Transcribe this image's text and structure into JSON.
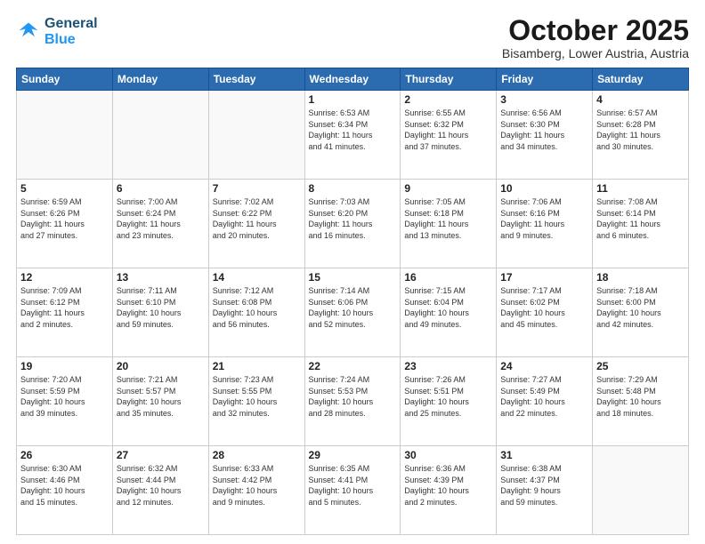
{
  "header": {
    "logo_line1": "General",
    "logo_line2": "Blue",
    "month": "October 2025",
    "location": "Bisamberg, Lower Austria, Austria"
  },
  "days_of_week": [
    "Sunday",
    "Monday",
    "Tuesday",
    "Wednesday",
    "Thursday",
    "Friday",
    "Saturday"
  ],
  "weeks": [
    [
      {
        "day": "",
        "info": ""
      },
      {
        "day": "",
        "info": ""
      },
      {
        "day": "",
        "info": ""
      },
      {
        "day": "1",
        "info": "Sunrise: 6:53 AM\nSunset: 6:34 PM\nDaylight: 11 hours\nand 41 minutes."
      },
      {
        "day": "2",
        "info": "Sunrise: 6:55 AM\nSunset: 6:32 PM\nDaylight: 11 hours\nand 37 minutes."
      },
      {
        "day": "3",
        "info": "Sunrise: 6:56 AM\nSunset: 6:30 PM\nDaylight: 11 hours\nand 34 minutes."
      },
      {
        "day": "4",
        "info": "Sunrise: 6:57 AM\nSunset: 6:28 PM\nDaylight: 11 hours\nand 30 minutes."
      }
    ],
    [
      {
        "day": "5",
        "info": "Sunrise: 6:59 AM\nSunset: 6:26 PM\nDaylight: 11 hours\nand 27 minutes."
      },
      {
        "day": "6",
        "info": "Sunrise: 7:00 AM\nSunset: 6:24 PM\nDaylight: 11 hours\nand 23 minutes."
      },
      {
        "day": "7",
        "info": "Sunrise: 7:02 AM\nSunset: 6:22 PM\nDaylight: 11 hours\nand 20 minutes."
      },
      {
        "day": "8",
        "info": "Sunrise: 7:03 AM\nSunset: 6:20 PM\nDaylight: 11 hours\nand 16 minutes."
      },
      {
        "day": "9",
        "info": "Sunrise: 7:05 AM\nSunset: 6:18 PM\nDaylight: 11 hours\nand 13 minutes."
      },
      {
        "day": "10",
        "info": "Sunrise: 7:06 AM\nSunset: 6:16 PM\nDaylight: 11 hours\nand 9 minutes."
      },
      {
        "day": "11",
        "info": "Sunrise: 7:08 AM\nSunset: 6:14 PM\nDaylight: 11 hours\nand 6 minutes."
      }
    ],
    [
      {
        "day": "12",
        "info": "Sunrise: 7:09 AM\nSunset: 6:12 PM\nDaylight: 11 hours\nand 2 minutes."
      },
      {
        "day": "13",
        "info": "Sunrise: 7:11 AM\nSunset: 6:10 PM\nDaylight: 10 hours\nand 59 minutes."
      },
      {
        "day": "14",
        "info": "Sunrise: 7:12 AM\nSunset: 6:08 PM\nDaylight: 10 hours\nand 56 minutes."
      },
      {
        "day": "15",
        "info": "Sunrise: 7:14 AM\nSunset: 6:06 PM\nDaylight: 10 hours\nand 52 minutes."
      },
      {
        "day": "16",
        "info": "Sunrise: 7:15 AM\nSunset: 6:04 PM\nDaylight: 10 hours\nand 49 minutes."
      },
      {
        "day": "17",
        "info": "Sunrise: 7:17 AM\nSunset: 6:02 PM\nDaylight: 10 hours\nand 45 minutes."
      },
      {
        "day": "18",
        "info": "Sunrise: 7:18 AM\nSunset: 6:00 PM\nDaylight: 10 hours\nand 42 minutes."
      }
    ],
    [
      {
        "day": "19",
        "info": "Sunrise: 7:20 AM\nSunset: 5:59 PM\nDaylight: 10 hours\nand 39 minutes."
      },
      {
        "day": "20",
        "info": "Sunrise: 7:21 AM\nSunset: 5:57 PM\nDaylight: 10 hours\nand 35 minutes."
      },
      {
        "day": "21",
        "info": "Sunrise: 7:23 AM\nSunset: 5:55 PM\nDaylight: 10 hours\nand 32 minutes."
      },
      {
        "day": "22",
        "info": "Sunrise: 7:24 AM\nSunset: 5:53 PM\nDaylight: 10 hours\nand 28 minutes."
      },
      {
        "day": "23",
        "info": "Sunrise: 7:26 AM\nSunset: 5:51 PM\nDaylight: 10 hours\nand 25 minutes."
      },
      {
        "day": "24",
        "info": "Sunrise: 7:27 AM\nSunset: 5:49 PM\nDaylight: 10 hours\nand 22 minutes."
      },
      {
        "day": "25",
        "info": "Sunrise: 7:29 AM\nSunset: 5:48 PM\nDaylight: 10 hours\nand 18 minutes."
      }
    ],
    [
      {
        "day": "26",
        "info": "Sunrise: 6:30 AM\nSunset: 4:46 PM\nDaylight: 10 hours\nand 15 minutes."
      },
      {
        "day": "27",
        "info": "Sunrise: 6:32 AM\nSunset: 4:44 PM\nDaylight: 10 hours\nand 12 minutes."
      },
      {
        "day": "28",
        "info": "Sunrise: 6:33 AM\nSunset: 4:42 PM\nDaylight: 10 hours\nand 9 minutes."
      },
      {
        "day": "29",
        "info": "Sunrise: 6:35 AM\nSunset: 4:41 PM\nDaylight: 10 hours\nand 5 minutes."
      },
      {
        "day": "30",
        "info": "Sunrise: 6:36 AM\nSunset: 4:39 PM\nDaylight: 10 hours\nand 2 minutes."
      },
      {
        "day": "31",
        "info": "Sunrise: 6:38 AM\nSunset: 4:37 PM\nDaylight: 9 hours\nand 59 minutes."
      },
      {
        "day": "",
        "info": ""
      }
    ]
  ]
}
